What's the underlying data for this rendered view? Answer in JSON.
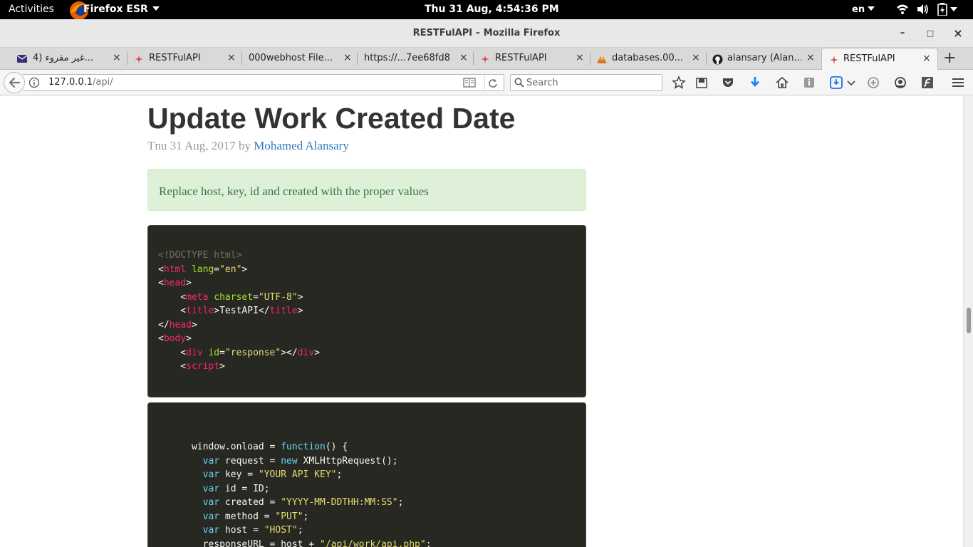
{
  "topbar": {
    "activities": "Activities",
    "app_name": "Firefox ESR",
    "clock": "Thu 31 Aug,  4:54:36 PM",
    "lang": "en"
  },
  "window": {
    "title": "RESTFulAPI – Mozilla Firefox",
    "minimize": "–",
    "maximize": "□",
    "close": "×"
  },
  "tabs": [
    {
      "label": "4) غير مقروء...",
      "icon": "mail-icon"
    },
    {
      "label": "RESTFulAPI",
      "icon": "restful-favicon-icon"
    },
    {
      "label": "000webhost File...",
      "icon": "none"
    },
    {
      "label": "https://...7ee68fd8",
      "icon": "none"
    },
    {
      "label": "RESTFulAPI",
      "icon": "restful-favicon-icon"
    },
    {
      "label": "databases.00...",
      "icon": "phpmyadmin-icon"
    },
    {
      "label": "alansary (Alan...",
      "icon": "github-icon"
    },
    {
      "label": "RESTFulAPI",
      "icon": "restful-favicon-icon",
      "active": true
    }
  ],
  "tab_close": "×",
  "new_tab": "+",
  "navbar": {
    "url_host": "127.0.0.1",
    "url_path": "/api/",
    "search_placeholder": "Search"
  },
  "page": {
    "title": "Update Work Created Date",
    "date": "Tnu 31 Aug, 2017",
    "by": "by",
    "author": "Mohamed Alansary",
    "alert": "Replace host, key, id and created with the proper values"
  },
  "code1": {
    "doctype": "<!DOCTYPE html>",
    "html_tag": "html",
    "lang_attr": "lang",
    "lang_val": "\"en\"",
    "head_tag": "head",
    "meta_tag": "meta",
    "charset_attr": "charset",
    "charset_val": "\"UTF-8\"",
    "title_tag": "title",
    "title_text": "TestAPI",
    "body_tag": "body",
    "div_tag": "div",
    "id_attr": "id",
    "id_val": "\"response\"",
    "script_tag": "script"
  },
  "code2": {
    "l1a": "window.onload = ",
    "l1kw": "function",
    "l1b": "() {",
    "var": "var",
    "new": "new",
    "l2": " request = ",
    "l2b": " XMLHttpRequest();",
    "l3": " key = ",
    "l3s": "\"YOUR API KEY\"",
    "l4": " id = ID;",
    "l5": " created = ",
    "l5s": "\"YYYY-MM-DDTHH:MM:SS\"",
    "l6": " method = ",
    "l6s": "\"PUT\"",
    "l7": " host = ",
    "l7s": "\"HOST\"",
    "l8a": "responseURL = host + ",
    "l8s": "\"/api/work/api.php\"",
    "semi": ";"
  }
}
